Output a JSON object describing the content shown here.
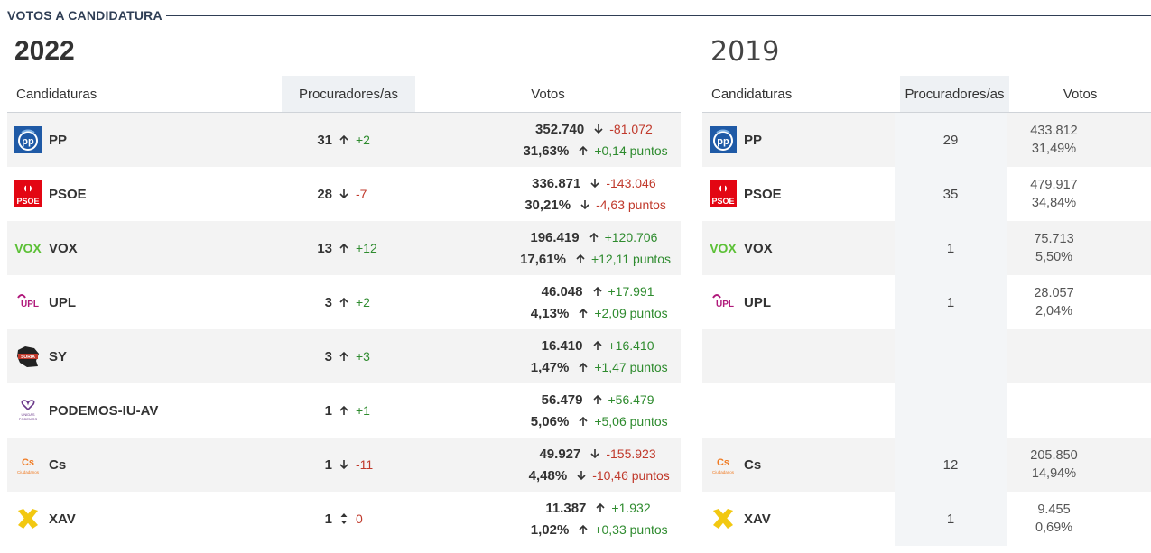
{
  "section_title": "VOTOS A CANDIDATURA",
  "year_2022": "2022",
  "year_2019": "2019",
  "headers": {
    "candidaturas": "Candidaturas",
    "procuradores": "Procuradores/as",
    "votos": "Votos"
  },
  "colors": {
    "up": "#2e8b2e",
    "down": "#c0392b",
    "title": "#2f3e55"
  },
  "rows_2022": [
    {
      "party": "PP",
      "logo": "pp-logo",
      "proc": "31",
      "proc_dir": "up",
      "proc_delta": "+2",
      "votes": "352.740",
      "votes_dir": "down",
      "votes_delta": "-81.072",
      "pct": "31,63%",
      "pct_dir": "up",
      "pct_delta": "+0,14 puntos"
    },
    {
      "party": "PSOE",
      "logo": "psoe-logo",
      "proc": "28",
      "proc_dir": "down",
      "proc_delta": "-7",
      "votes": "336.871",
      "votes_dir": "down",
      "votes_delta": "-143.046",
      "pct": "30,21%",
      "pct_dir": "down",
      "pct_delta": "-4,63 puntos"
    },
    {
      "party": "VOX",
      "logo": "vox-logo",
      "proc": "13",
      "proc_dir": "up",
      "proc_delta": "+12",
      "votes": "196.419",
      "votes_dir": "up",
      "votes_delta": "+120.706",
      "pct": "17,61%",
      "pct_dir": "up",
      "pct_delta": "+12,11 puntos"
    },
    {
      "party": "UPL",
      "logo": "upl-logo",
      "proc": "3",
      "proc_dir": "up",
      "proc_delta": "+2",
      "votes": "46.048",
      "votes_dir": "up",
      "votes_delta": "+17.991",
      "pct": "4,13%",
      "pct_dir": "up",
      "pct_delta": "+2,09 puntos"
    },
    {
      "party": "SY",
      "logo": "sy-logo",
      "proc": "3",
      "proc_dir": "up",
      "proc_delta": "+3",
      "votes": "16.410",
      "votes_dir": "up",
      "votes_delta": "+16.410",
      "pct": "1,47%",
      "pct_dir": "up",
      "pct_delta": "+1,47 puntos"
    },
    {
      "party": "PODEMOS-IU-AV",
      "logo": "podemos-logo",
      "proc": "1",
      "proc_dir": "up",
      "proc_delta": "+1",
      "votes": "56.479",
      "votes_dir": "up",
      "votes_delta": "+56.479",
      "pct": "5,06%",
      "pct_dir": "up",
      "pct_delta": "+5,06 puntos"
    },
    {
      "party": "Cs",
      "logo": "cs-logo",
      "proc": "1",
      "proc_dir": "down",
      "proc_delta": "-11",
      "votes": "49.927",
      "votes_dir": "down",
      "votes_delta": "-155.923",
      "pct": "4,48%",
      "pct_dir": "down",
      "pct_delta": "-10,46 puntos"
    },
    {
      "party": "XAV",
      "logo": "xav-logo",
      "proc": "1",
      "proc_dir": "same",
      "proc_delta": "0",
      "votes": "11.387",
      "votes_dir": "up",
      "votes_delta": "+1.932",
      "pct": "1,02%",
      "pct_dir": "up",
      "pct_delta": "+0,33 puntos"
    }
  ],
  "rows_2019": [
    {
      "party": "PP",
      "logo": "pp-logo",
      "proc": "29",
      "votes": "433.812",
      "pct": "31,49%"
    },
    {
      "party": "PSOE",
      "logo": "psoe-logo",
      "proc": "35",
      "votes": "479.917",
      "pct": "34,84%"
    },
    {
      "party": "VOX",
      "logo": "vox-logo",
      "proc": "1",
      "votes": "75.713",
      "pct": "5,50%"
    },
    {
      "party": "UPL",
      "logo": "upl-logo",
      "proc": "1",
      "votes": "28.057",
      "pct": "2,04%"
    },
    {
      "party": "",
      "logo": "",
      "proc": "",
      "votes": "",
      "pct": ""
    },
    {
      "party": "",
      "logo": "",
      "proc": "",
      "votes": "",
      "pct": ""
    },
    {
      "party": "Cs",
      "logo": "cs-logo",
      "proc": "12",
      "votes": "205.850",
      "pct": "14,94%"
    },
    {
      "party": "XAV",
      "logo": "xav-logo",
      "proc": "1",
      "votes": "9.455",
      "pct": "0,69%"
    }
  ]
}
